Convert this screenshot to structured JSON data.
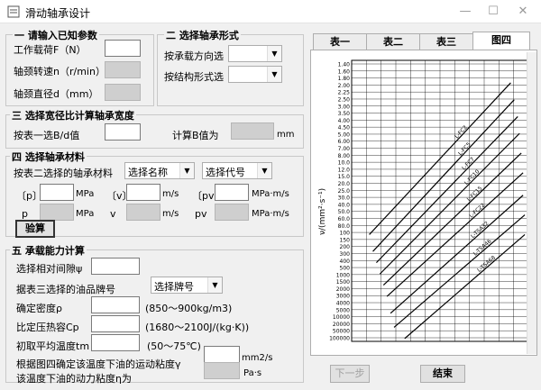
{
  "window": {
    "title": "滑动轴承设计",
    "minimize": "—",
    "maximize": "☐",
    "close": "✕"
  },
  "section1": {
    "title": "一 请输入已知参数",
    "load_label": "工作载荷F（N）",
    "speed_label": "轴颈转速n（r/min）",
    "diameter_label": "轴颈直径d（mm）"
  },
  "section2": {
    "title": "二 选择轴承形式",
    "direction_label": "按承载方向选",
    "structure_label": "按结构形式选",
    "direction_value": "",
    "structure_value": ""
  },
  "section3": {
    "title": "三 选择宽径比计算轴承宽度",
    "bd_label": "按表一选B/d值",
    "calc_label": "计算B值为",
    "unit_mm": "mm"
  },
  "section4": {
    "title": "四 选择轴承材料",
    "material_label": "按表二选择的轴承材料",
    "name_select": "选择名称",
    "code_select": "选择代号",
    "p_label": "〔p〕",
    "v_label": "〔v〕",
    "pv_label": "〔pv〕",
    "p_calc_label": "p",
    "v_calc_label": "v",
    "pv_calc_label": "pv",
    "unit_mpa": "MPa",
    "unit_ms": "m/s",
    "unit_mpams": "MPa·m/s",
    "check_button": "验算"
  },
  "section5": {
    "title": "五 承载能力计算",
    "clearance_label": "选择相对间隙ψ",
    "oil_label": "据表三选择的油品牌号",
    "oil_select": "选择牌号",
    "density_label": "确定密度ρ",
    "density_range": "(850～900kg/m3)",
    "heat_label": "比定压热容Cp",
    "heat_range": "(1680～2100J/(kg·K))",
    "temp_label": "初取平均温度tm",
    "temp_range": "(50～75℃)",
    "kin_visc_label": "根据图四确定该温度下油的运动粘度γ",
    "kin_visc_unit": "mm2/s",
    "dyn_visc_label": "该温度下油的动力粘度η为",
    "dyn_visc_unit": "Pa·s"
  },
  "tabs": [
    "表一",
    "表二",
    "表三",
    "图四"
  ],
  "active_tab": 3,
  "buttons": {
    "next": "下一步",
    "finish": "结束"
  },
  "chart_data": {
    "type": "line",
    "title": "",
    "ylabel": "ν/(mm²·s⁻¹)",
    "y_scale": "viscosity-temperature (log-log)",
    "y_ticks": [
      "1.40",
      "1.60",
      "1.80",
      "2.00",
      "2.25",
      "2.50",
      "3.00",
      "3.50",
      "4.00",
      "4.50",
      "5.00",
      "6.00",
      "7.00",
      "8.00",
      "10.0",
      "12.0",
      "15.0",
      "20.0",
      "25.0",
      "30.0",
      "40.0",
      "50.0",
      "60.0",
      "80.0",
      "100",
      "150",
      "200",
      "300",
      "400",
      "500",
      "1000",
      "1500",
      "2000",
      "3000",
      "4000",
      "5000",
      "10000",
      "20000",
      "50000",
      "100000"
    ],
    "series": [
      {
        "name": "L-FC2",
        "x_frac": [
          0.1,
          0.9
        ],
        "y_frac": [
          0.62,
          0.08
        ]
      },
      {
        "name": "L-FC5",
        "x_frac": [
          0.12,
          0.92
        ],
        "y_frac": [
          0.68,
          0.14
        ]
      },
      {
        "name": "L-FC7",
        "x_frac": [
          0.14,
          0.94
        ],
        "y_frac": [
          0.72,
          0.2
        ]
      },
      {
        "name": "L-FC10",
        "x_frac": [
          0.16,
          0.95
        ],
        "y_frac": [
          0.76,
          0.26
        ]
      },
      {
        "name": "L-FC15",
        "x_frac": [
          0.18,
          0.96
        ],
        "y_frac": [
          0.8,
          0.33
        ]
      },
      {
        "name": "L-FC22",
        "x_frac": [
          0.2,
          0.97
        ],
        "y_frac": [
          0.84,
          0.4
        ]
      },
      {
        "name": "L-TSA32",
        "x_frac": [
          0.22,
          0.97
        ],
        "y_frac": [
          0.9,
          0.48
        ]
      },
      {
        "name": "L-TSA46",
        "x_frac": [
          0.24,
          0.98
        ],
        "y_frac": [
          0.95,
          0.55
        ]
      },
      {
        "name": "L-TSA68",
        "x_frac": [
          0.3,
          0.98
        ],
        "y_frac": [
          0.99,
          0.62
        ]
      }
    ]
  }
}
